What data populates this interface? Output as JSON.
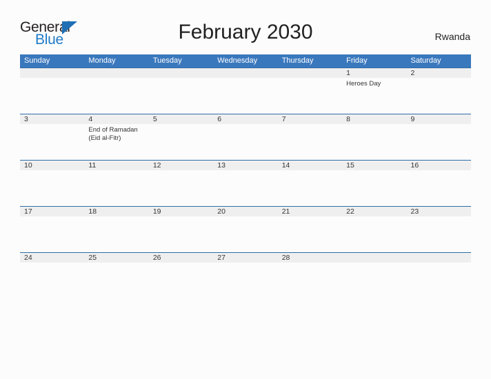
{
  "brand": {
    "name_part1": "General",
    "name_part2": "Blue",
    "triangle_color": "#1f6fb5",
    "blue_text_color": "#1f7ac4"
  },
  "header": {
    "title": "February 2030",
    "region": "Rwanda"
  },
  "theme": {
    "header_blue": "#3a78bd",
    "row_divider_blue": "#2e6da4",
    "daynum_band": "#efefef",
    "page_background": "#fcfcfd"
  },
  "calendar": {
    "month": "February",
    "year": "2030",
    "weekday_headers": [
      "Sunday",
      "Monday",
      "Tuesday",
      "Wednesday",
      "Thursday",
      "Friday",
      "Saturday"
    ],
    "weeks": [
      [
        {
          "day": "",
          "events": []
        },
        {
          "day": "",
          "events": []
        },
        {
          "day": "",
          "events": []
        },
        {
          "day": "",
          "events": []
        },
        {
          "day": "",
          "events": []
        },
        {
          "day": "1",
          "events": [
            "Heroes Day"
          ]
        },
        {
          "day": "2",
          "events": []
        }
      ],
      [
        {
          "day": "3",
          "events": []
        },
        {
          "day": "4",
          "events": [
            "End of Ramadan\n(Eid al-Fitr)"
          ]
        },
        {
          "day": "5",
          "events": []
        },
        {
          "day": "6",
          "events": []
        },
        {
          "day": "7",
          "events": []
        },
        {
          "day": "8",
          "events": []
        },
        {
          "day": "9",
          "events": []
        }
      ],
      [
        {
          "day": "10",
          "events": []
        },
        {
          "day": "11",
          "events": []
        },
        {
          "day": "12",
          "events": []
        },
        {
          "day": "13",
          "events": []
        },
        {
          "day": "14",
          "events": []
        },
        {
          "day": "15",
          "events": []
        },
        {
          "day": "16",
          "events": []
        }
      ],
      [
        {
          "day": "17",
          "events": []
        },
        {
          "day": "18",
          "events": []
        },
        {
          "day": "19",
          "events": []
        },
        {
          "day": "20",
          "events": []
        },
        {
          "day": "21",
          "events": []
        },
        {
          "day": "22",
          "events": []
        },
        {
          "day": "23",
          "events": []
        }
      ],
      [
        {
          "day": "24",
          "events": []
        },
        {
          "day": "25",
          "events": []
        },
        {
          "day": "26",
          "events": []
        },
        {
          "day": "27",
          "events": []
        },
        {
          "day": "28",
          "events": []
        },
        {
          "day": "",
          "events": []
        },
        {
          "day": "",
          "events": []
        }
      ]
    ]
  }
}
